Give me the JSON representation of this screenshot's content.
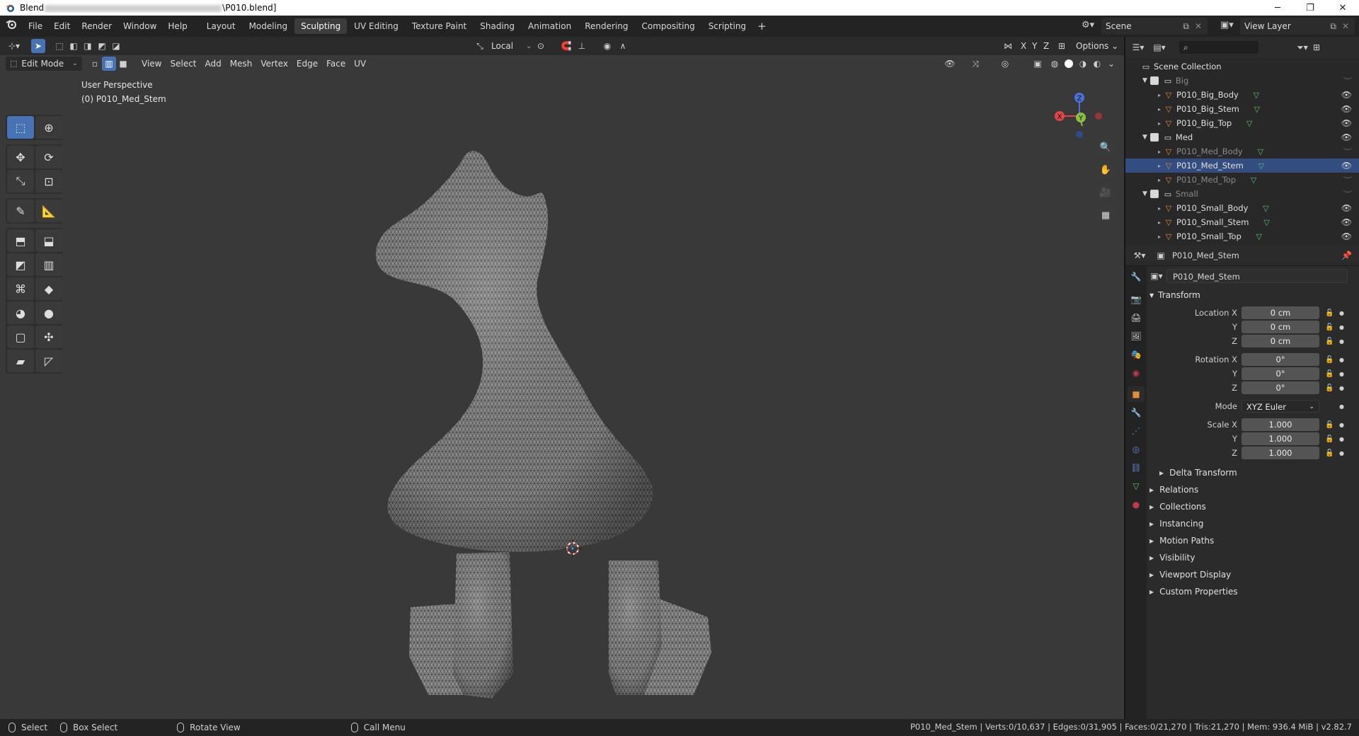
{
  "window": {
    "title_prefix": "Blend",
    "title_suffix": "\\P010.blend]",
    "controls": [
      "─",
      "❐",
      "✕"
    ]
  },
  "topbar": {
    "menus": [
      "File",
      "Edit",
      "Render",
      "Window",
      "Help"
    ],
    "workspaces": [
      "Layout",
      "Modeling",
      "Sculpting",
      "UV Editing",
      "Texture Paint",
      "Shading",
      "Animation",
      "Rendering",
      "Compositing",
      "Scripting"
    ],
    "active_workspace": "Sculpting",
    "add_label": "+",
    "scene": "Scene",
    "view_layer": "View Layer"
  },
  "viewport_header": {
    "transform_orientation": "Local",
    "axes": [
      "X",
      "Y",
      "Z"
    ],
    "options_label": "Options",
    "mode": "Edit Mode",
    "menus": [
      "View",
      "Select",
      "Add",
      "Mesh",
      "Vertex",
      "Edge",
      "Face",
      "UV"
    ]
  },
  "viewport": {
    "perspective_label": "User Perspective",
    "object_label": "(0) P010_Med_Stem",
    "gizmo_axes": [
      "X",
      "Y",
      "Z"
    ]
  },
  "outliner": {
    "root": "Scene Collection",
    "collections": [
      {
        "name": "Big",
        "dim": true,
        "objects": [
          {
            "name": "P010_Big_Body",
            "dim": false,
            "selected": false
          },
          {
            "name": "P010_Big_Stem",
            "dim": false,
            "selected": false
          },
          {
            "name": "P010_Big_Top",
            "dim": false,
            "selected": false
          }
        ]
      },
      {
        "name": "Med",
        "dim": false,
        "objects": [
          {
            "name": "P010_Med_Body",
            "dim": true,
            "selected": false
          },
          {
            "name": "P010_Med_Stem",
            "dim": false,
            "selected": true
          },
          {
            "name": "P010_Med_Top",
            "dim": true,
            "selected": false
          }
        ]
      },
      {
        "name": "Small",
        "dim": true,
        "objects": [
          {
            "name": "P010_Small_Body",
            "dim": false,
            "selected": false
          },
          {
            "name": "P010_Small_Stem",
            "dim": false,
            "selected": false
          },
          {
            "name": "P010_Small_Top",
            "dim": false,
            "selected": false
          }
        ]
      }
    ]
  },
  "properties": {
    "object_name": "P010_Med_Stem",
    "datablock_name": "P010_Med_Stem",
    "transform_label": "Transform",
    "location": {
      "label": "Location X",
      "x": "0 cm",
      "y": "0 cm",
      "z": "0 cm"
    },
    "rotation": {
      "label": "Rotation X",
      "x": "0°",
      "y": "0°",
      "z": "0°"
    },
    "mode_label": "Mode",
    "mode_value": "XYZ Euler",
    "scale": {
      "label": "Scale X",
      "x": "1.000",
      "y": "1.000",
      "z": "1.000"
    },
    "axis_y": "Y",
    "axis_z": "Z",
    "delta_transform": "Delta Transform",
    "panels": [
      "Relations",
      "Collections",
      "Instancing",
      "Motion Paths",
      "Visibility",
      "Viewport Display",
      "Custom Properties"
    ]
  },
  "statusbar": {
    "select": "Select",
    "box_select": "Box Select",
    "rotate_view": "Rotate View",
    "call_menu": "Call Menu",
    "stats": "P010_Med_Stem | Verts:0/10,637 | Edges:0/31,905 | Faces:0/21,270 | Tris:21,270 | Mem: 936.4 MiB | v2.82.7"
  },
  "colors": {
    "accent": "#4772b3",
    "selected_row": "#334d80",
    "viewport_bg": "#393939",
    "x_axis": "#e04545",
    "y_axis": "#8ac040",
    "z_axis": "#4a72d8"
  }
}
